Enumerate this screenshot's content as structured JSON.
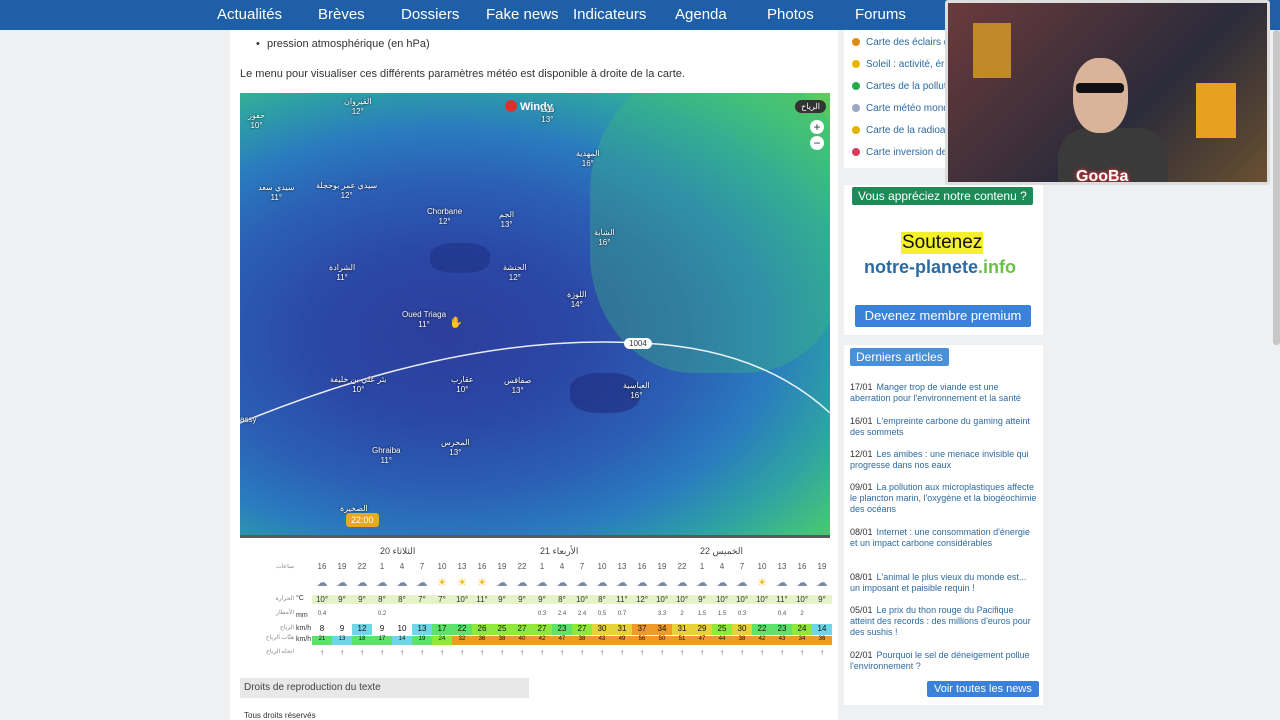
{
  "nav": [
    "Actualités",
    "Brèves",
    "Dossiers",
    "Fake news",
    "Indicateurs",
    "Agenda",
    "Photos",
    "Forums"
  ],
  "article": {
    "bullet": "pression atmosphérique (en hPa)",
    "intro": "Le menu pour visualiser ces différents paramètres météo est disponible à droite de la carte."
  },
  "map": {
    "logo": "Windy",
    "layer_button": "الرياح",
    "zoom_in": "+",
    "zoom_out": "−",
    "isobar_value": "1004",
    "time": "22:00",
    "cities": [
      {
        "name": "حفوز",
        "temp": "10°"
      },
      {
        "name": "القيروان",
        "temp": "12°"
      },
      {
        "name": "قلعة",
        "temp": "13°"
      },
      {
        "name": "المهدية",
        "temp": "16°"
      },
      {
        "name": "سيدي سعد",
        "temp": "11°"
      },
      {
        "name": "سيدي عمر بوحجلة",
        "temp": "12°"
      },
      {
        "name": "Chorbane",
        "temp": "12°"
      },
      {
        "name": "الجم",
        "temp": "13°"
      },
      {
        "name": "الشابة",
        "temp": "16°"
      },
      {
        "name": "الشرادة",
        "temp": "11°"
      },
      {
        "name": "الحنشة",
        "temp": "12°"
      },
      {
        "name": "اللوزة",
        "temp": "14°"
      },
      {
        "name": "Oued Triaga",
        "temp": "11°"
      },
      {
        "name": "بئر علي بن خليفة",
        "temp": "10°"
      },
      {
        "name": "عقارب",
        "temp": "10°"
      },
      {
        "name": "صفاقس",
        "temp": "13°"
      },
      {
        "name": "العباسية",
        "temp": "16°"
      },
      {
        "name": "Ghraiba",
        "temp": "11°"
      },
      {
        "name": "المحرس",
        "temp": "13°"
      },
      {
        "name": "الصخيرة",
        "temp": ""
      },
      {
        "name": "assy",
        "temp": ""
      }
    ]
  },
  "forecast": {
    "days": [
      "الثلاثاء 20",
      "الأربعاء 21",
      "الخميس 22"
    ],
    "row_labels": [
      "ساعات",
      "الحرارة",
      "الأمطار",
      "الرياح",
      "هبّات الرياح",
      "اتجاه الرياح"
    ],
    "units": [
      "°C",
      "mm",
      "km/h",
      "km/h"
    ],
    "hours": [
      "16",
      "19",
      "22",
      "1",
      "4",
      "7",
      "10",
      "13",
      "16",
      "19",
      "22",
      "1",
      "4",
      "7",
      "10",
      "13",
      "16",
      "19",
      "22",
      "1",
      "4",
      "7",
      "10",
      "13",
      "16",
      "19"
    ],
    "temps": [
      "10°",
      "9°",
      "9°",
      "8°",
      "8°",
      "7°",
      "7°",
      "10°",
      "11°",
      "9°",
      "9°",
      "9°",
      "8°",
      "10°",
      "8°",
      "11°",
      "12°",
      "10°",
      "10°",
      "9°",
      "10°",
      "10°",
      "10°",
      "11°",
      "10°",
      "9°"
    ],
    "rain": [
      "0.4",
      "",
      "",
      "0.2",
      "",
      "",
      "",
      "",
      "",
      "",
      "",
      "0.3",
      "2.4",
      "2.4",
      "0.5",
      "0.7",
      "",
      "3.3",
      "2",
      "1.5",
      "1.5",
      "0.3",
      "",
      "0.4",
      "2",
      ""
    ],
    "wind": [
      "8",
      "9",
      "12",
      "9",
      "10",
      "13",
      "17",
      "22",
      "26",
      "25",
      "27",
      "27",
      "23",
      "27",
      "30",
      "31",
      "37",
      "34",
      "31",
      "29",
      "25",
      "30",
      "22",
      "23",
      "24",
      "14"
    ],
    "gusts": [
      "21",
      "13",
      "18",
      "17",
      "14",
      "19",
      "24",
      "32",
      "36",
      "38",
      "40",
      "42",
      "47",
      "38",
      "43",
      "49",
      "56",
      "50",
      "51",
      "47",
      "44",
      "38",
      "42",
      "43",
      "34",
      "36"
    ]
  },
  "rights": {
    "heading": "Droits de reproduction du texte",
    "text": "Tous droits réservés"
  },
  "sidebar": {
    "links": [
      "Carte des éclairs d...",
      "Soleil : activité, érup...",
      "Cartes de la pollutio...",
      "Carte météo mondi...",
      "Carte de la radioact...",
      "Carte inversion des..."
    ],
    "support": {
      "tag": "Vous appréciez notre contenu ?",
      "headline": "Soutenez",
      "brand_main": "notre-planete",
      "brand_ext": ".info",
      "button": "Devenez membre premium"
    },
    "latest": {
      "tag": "Derniers articles",
      "items": [
        {
          "date": "17/01",
          "title": "Manger trop de viande est une aberration pour l'environnement et la santé"
        },
        {
          "date": "16/01",
          "title": "L'empreinte carbone du gaming atteint des sommets"
        },
        {
          "date": "12/01",
          "title": "Les amibes : une menace invisible qui progresse dans nos eaux"
        },
        {
          "date": "09/01",
          "title": "La pollution aux microplastiques affecte le plancton marin, l'oxygène et la biogéochimie des océans"
        },
        {
          "date": "08/01",
          "title": "Internet : une consommation d'énergie et un impact carbone considérables"
        },
        {
          "date": "08/01",
          "title": "L'animal le plus vieux du monde est... un imposant et paisible requin !"
        },
        {
          "date": "05/01",
          "title": "Le prix du thon rouge du Pacifique atteint des records : des millions d'euros pour des sushis !"
        },
        {
          "date": "02/01",
          "title": "Pourquoi le sel de déneigement pollue l'environnement ?"
        }
      ],
      "button": "Voir toutes les news"
    }
  },
  "webcam": {
    "overlay": "GooBa"
  },
  "colors": {
    "nav": "#1f5fa8",
    "accent_green": "#1e8a57",
    "accent_blue": "#4a90d9",
    "link": "#2d6aa0"
  }
}
